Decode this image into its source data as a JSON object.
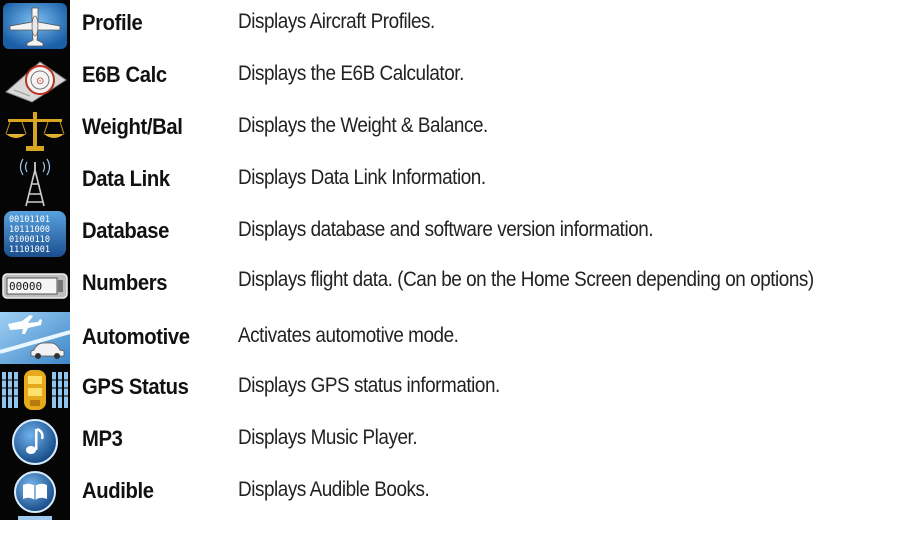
{
  "rows": [
    {
      "name": "Profile",
      "description": "Displays Aircraft Profiles.",
      "icon": "airplane-icon"
    },
    {
      "name": "E6B Calc",
      "description": "Displays the E6B Calculator.",
      "icon": "e6b-calculator-icon"
    },
    {
      "name": "Weight/Bal",
      "description": "Displays the Weight & Balance.",
      "icon": "balance-scale-icon"
    },
    {
      "name": "Data Link",
      "description": "Displays Data Link Information.",
      "icon": "radio-tower-icon"
    },
    {
      "name": "Database",
      "description": "Displays database and software version information.",
      "icon": "database-binary-icon"
    },
    {
      "name": "Numbers",
      "description": "Displays flight data. (Can be on the Home Screen depending on options)",
      "icon": "odometer-counter-icon"
    },
    {
      "name": "Automotive",
      "description": "Activates automotive mode.",
      "icon": "car-airplane-icon"
    },
    {
      "name": "GPS Status",
      "description": "Displays GPS status information.",
      "icon": "gps-satellite-icon"
    },
    {
      "name": "MP3",
      "description": "Displays Music Player.",
      "icon": "music-note-icon"
    },
    {
      "name": "Audible",
      "description": "Displays Audible Books.",
      "icon": "audible-book-icon"
    }
  ],
  "icons": {
    "database_digits": [
      "00101101",
      "10111000",
      "01000110",
      "11101001"
    ],
    "odometer_digits": "00000"
  },
  "colors": {
    "icon_bg": "#050505",
    "blue": "#2f7fc4",
    "gold": "#d9a521",
    "text": "#1a1a1a"
  }
}
